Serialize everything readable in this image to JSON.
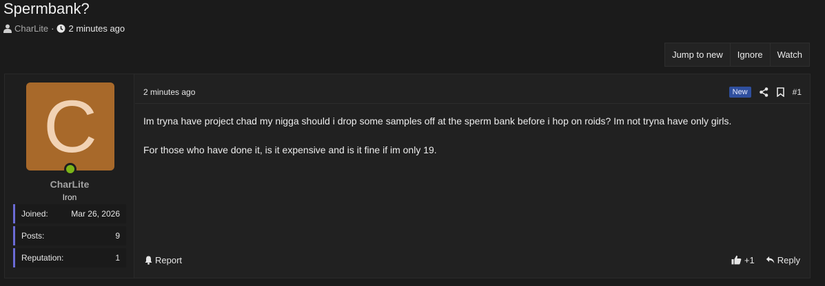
{
  "thread": {
    "title": "Spermbank?",
    "author": "CharLite",
    "separator": "·",
    "time": "2 minutes ago"
  },
  "actions": {
    "jump_to_new": "Jump to new",
    "ignore": "Ignore",
    "watch": "Watch"
  },
  "user": {
    "avatar_letter": "C",
    "avatar_color": "#a8692a",
    "online_color": "#7cb518",
    "name": "CharLite",
    "rank": "Iron",
    "stats": [
      {
        "label": "Joined:",
        "value": "Mar 26, 2026"
      },
      {
        "label": "Posts:",
        "value": "9"
      },
      {
        "label": "Reputation:",
        "value": "1"
      }
    ]
  },
  "post": {
    "time": "2 minutes ago",
    "badge": "New",
    "number": "#1",
    "paragraphs": [
      "Im tryna have project chad my nigga should i drop some samples off at the sperm bank before i hop on roids? Im not tryna have only girls.",
      "For those who have done it, is it expensive and is it fine if im only 19."
    ],
    "report_label": "Report",
    "reaction_count": "+1",
    "reply_label": "Reply"
  },
  "icons": {
    "user": "user-icon",
    "clock": "clock-icon",
    "share": "share-icon",
    "bookmark": "bookmark-icon",
    "bell": "bell-icon",
    "thumbs_up": "thumbs-up-icon",
    "reply": "reply-icon"
  }
}
